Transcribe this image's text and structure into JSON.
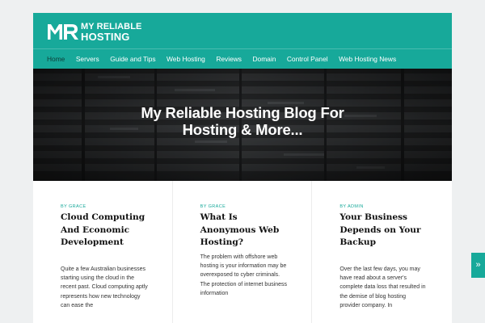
{
  "site": {
    "logo_mark": "MR",
    "logo_line1": "MY RELIABLE",
    "logo_line2": "HOSTING",
    "brand_color": "#17a99a"
  },
  "nav": [
    {
      "label": "Home",
      "active": true
    },
    {
      "label": "Servers"
    },
    {
      "label": "Guide and Tips"
    },
    {
      "label": "Web Hosting"
    },
    {
      "label": "Reviews"
    },
    {
      "label": "Domain"
    },
    {
      "label": "Control Panel"
    },
    {
      "label": "Web Hosting News"
    }
  ],
  "hero": {
    "title_line1": "My Reliable Hosting Blog For",
    "title_line2": "Hosting & More..."
  },
  "cards": [
    {
      "meta": "BY GRACE",
      "title": "Cloud Computing And Economic Development",
      "excerpt": "Quite a few Australian businesses starting using the cloud in the recent past. Cloud computing aptly represents how new technology can ease the"
    },
    {
      "meta": "BY GRACE",
      "title": "What Is Anonymous Web Hosting?",
      "excerpt": "The problem with offshore web hosting is your information may be overexposed to cyber criminals. The protection of internet business information"
    },
    {
      "meta": "BY ADMIN",
      "title": "Your Business Depends on Your Backup",
      "excerpt": "Over the last few days, you may have read about a server's complete data loss that resulted in the demise of blog hosting provider company. In"
    }
  ],
  "side_tab": {
    "icon": "double-chevron-right-icon",
    "glyph": "»"
  }
}
